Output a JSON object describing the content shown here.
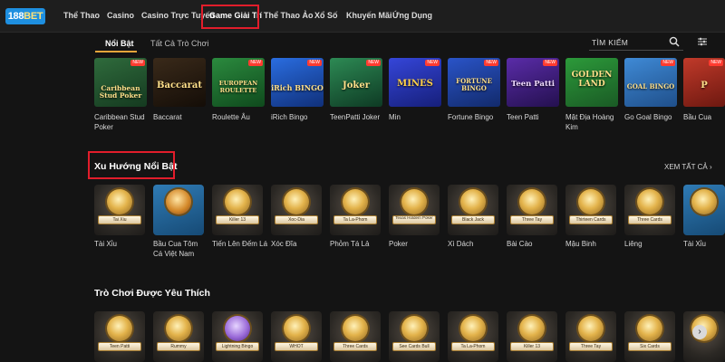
{
  "logo": {
    "text_a": "188",
    "text_b": "BET"
  },
  "nav": [
    {
      "label": "Thể Thao"
    },
    {
      "label": "Casino"
    },
    {
      "label": "Casino Trực Tuyến"
    },
    {
      "label": "Game Giải Trí"
    },
    {
      "label": "Thể Thao Ảo"
    },
    {
      "label": "Xổ Số"
    },
    {
      "label": "Khuyến Mãi"
    },
    {
      "label": "Ứng Dụng"
    }
  ],
  "subtabs": [
    {
      "label": "Nổi Bật"
    },
    {
      "label": "Tất Cả Trò Chơi"
    }
  ],
  "search": {
    "placeholder": "TÌM KIẾM"
  },
  "featured_games": [
    {
      "art": "Caribbean Stud Poker",
      "label": "Caribbean Stud Poker",
      "badge": "NEW"
    },
    {
      "art": "Baccarat",
      "label": "Baccarat",
      "badge": ""
    },
    {
      "art": "EUROPEAN ROULETTE",
      "label": "Roulette Âu",
      "badge": "NEW"
    },
    {
      "art": "iRich BINGO",
      "label": "iRich Bingo",
      "badge": "NEW"
    },
    {
      "art": "Joker",
      "label": "TeenPatti Joker",
      "badge": "NEW"
    },
    {
      "art": "MINES",
      "label": "Min",
      "badge": "NEW"
    },
    {
      "art": "FORTUNE BINGO",
      "label": "Fortune Bingo",
      "badge": "NEW"
    },
    {
      "art": "Teen Patti",
      "label": "Teen Patti",
      "badge": "NEW"
    },
    {
      "art": "GOLDEN LAND",
      "label": "Mật Địa Hoàng Kim",
      "badge": ""
    },
    {
      "art": "GOAL BINGO",
      "label": "Go Goal Bingo",
      "badge": "NEW"
    },
    {
      "art": "P",
      "label": "Bầu Cua",
      "badge": "NEW"
    }
  ],
  "trending": {
    "title": "Xu Hướng Nổi Bật",
    "see_all": "XEM TẤT CẢ",
    "items": [
      {
        "ribbon": "Tai Xiu",
        "label": "Tài Xỉu"
      },
      {
        "ribbon": "",
        "label": "Bầu Cua Tôm Cá Việt Nam"
      },
      {
        "ribbon": "Killer 13",
        "label": "Tiến Lên Đếm Lá"
      },
      {
        "ribbon": "Xoc-Dia",
        "label": "Xóc Đĩa"
      },
      {
        "ribbon": "Ta La-Phom",
        "label": "Phỏm Tá Lả"
      },
      {
        "ribbon": "Texas Holdem Poker",
        "label": "Poker"
      },
      {
        "ribbon": "Black Jack",
        "label": "Xì Dách"
      },
      {
        "ribbon": "Three Tay",
        "label": "Bài Cào"
      },
      {
        "ribbon": "Thirteen Cards",
        "label": "Mậu Binh"
      },
      {
        "ribbon": "Three Cards",
        "label": "Liêng"
      },
      {
        "ribbon": "",
        "label": "Tài Xỉu"
      }
    ]
  },
  "favorites": {
    "title": "Trò Chơi Được Yêu Thích",
    "items": [
      {
        "ribbon": "Teen Patti"
      },
      {
        "ribbon": "Rummy"
      },
      {
        "ribbon": "Lightning Bingo"
      },
      {
        "ribbon": "WHOT"
      },
      {
        "ribbon": "Three Cards"
      },
      {
        "ribbon": "See Cards Bull"
      },
      {
        "ribbon": "Ta La-Phom"
      },
      {
        "ribbon": "Killer 13"
      },
      {
        "ribbon": "Three Tay"
      },
      {
        "ribbon": "Six Cards"
      },
      {
        "ribbon": ""
      }
    ]
  },
  "colors": {
    "accent": "#e8a53a",
    "highlight_box": "#e21d2b",
    "logo_bg": "#1e8fe0",
    "background": "#141414"
  }
}
